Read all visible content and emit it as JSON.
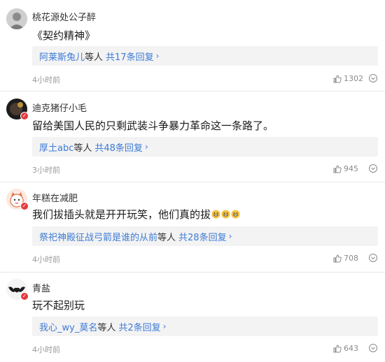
{
  "colors": {
    "link": "#3d7bd6",
    "separator": "#e8e8e8",
    "reply_bg": "#f3f3f3",
    "badge": "#e4393c"
  },
  "comments": [
    {
      "username": "桃花源处公子醉",
      "content": "《契约精神》",
      "reply_users": "阿莱斯兔儿",
      "reply_mid": "等人",
      "reply_count": "共17条回复",
      "time": "4小时前",
      "likes": "1302",
      "verified": false,
      "avatar_icon": "gray-silhouette-avatar"
    },
    {
      "username": "迪克猪仔小毛",
      "content": "留给美国人民的只剩武装斗争暴力革命这一条路了。",
      "reply_users": "厚土abc",
      "reply_mid": "等人",
      "reply_count": "共48条回复",
      "time": "3小时前",
      "likes": "945",
      "verified": true,
      "avatar_icon": "dark-photo-avatar"
    },
    {
      "username": "年糕在减肥",
      "content": "我们拔插头就是开开玩笑，他们真的拔",
      "content_emoji": [
        "grin-emoji",
        "grin-emoji",
        "grin-emoji"
      ],
      "reply_users": "祭祀神殿征战弓箭是谁的从前",
      "reply_mid": "等人",
      "reply_count": "共28条回复",
      "time": "4小时前",
      "likes": "708",
      "verified": true,
      "avatar_icon": "cat-cartoon-avatar"
    },
    {
      "username": "青盐",
      "content": "玩不起别玩",
      "reply_users": "我心_wy_莫名",
      "reply_mid": "等人",
      "reply_count": "共2条回复",
      "time": "4小时前",
      "likes": "643",
      "verified": true,
      "avatar_icon": "bat-avatar"
    }
  ]
}
